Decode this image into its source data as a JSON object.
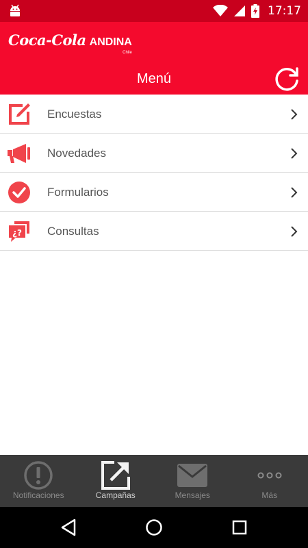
{
  "status_bar": {
    "time": "17:17"
  },
  "header": {
    "brand_primary": "Coca-Cola",
    "brand_secondary": "ANDINA",
    "brand_region": "Chile",
    "title": "Menú"
  },
  "menu": {
    "items": [
      {
        "label": "Encuestas",
        "icon": "edit-icon"
      },
      {
        "label": "Novedades",
        "icon": "megaphone-icon"
      },
      {
        "label": "Formularios",
        "icon": "check-circle-icon"
      },
      {
        "label": "Consultas",
        "icon": "question-chat-icon"
      }
    ]
  },
  "bottom_nav": {
    "items": [
      {
        "label": "Notificaciones",
        "icon": "alert-circle-icon"
      },
      {
        "label": "Campañas",
        "icon": "external-link-icon",
        "active": true
      },
      {
        "label": "Mensajes",
        "icon": "envelope-icon"
      },
      {
        "label": "Más",
        "icon": "more-dots-icon"
      }
    ]
  },
  "colors": {
    "status_bar": "#c8001d",
    "header": "#f40a2d",
    "icon_red": "#f0444b",
    "bottom_nav": "#3a3a3a"
  }
}
